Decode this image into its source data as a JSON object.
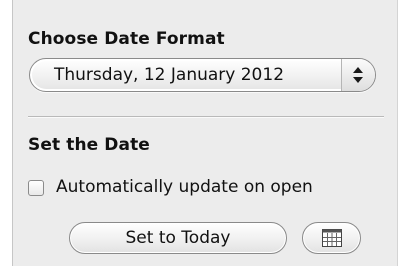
{
  "date_format": {
    "heading": "Choose Date Format",
    "selected": "Thursday, 12 January 2012"
  },
  "set_date": {
    "heading": "Set the Date",
    "auto_update": {
      "label": "Automatically update on open",
      "checked": false
    },
    "today_button": "Set to Today",
    "calendar_button_icon": "calendar-icon"
  }
}
